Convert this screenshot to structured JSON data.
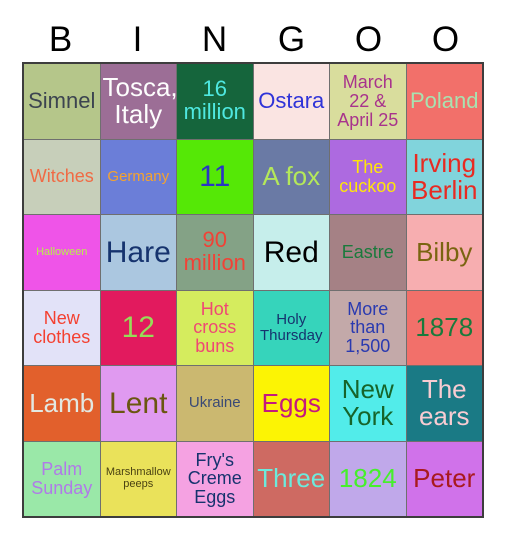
{
  "header": {
    "letters": [
      "B",
      "I",
      "N",
      "G",
      "O",
      "O"
    ],
    "letter_color": "#000000"
  },
  "grid": {
    "rows": 6,
    "columns": 6,
    "border_color": "#3d3d3d",
    "gridline_color": "#6f6f6f"
  },
  "cells": [
    {
      "text": "Simnel",
      "bg": "#b5c68a",
      "fg": "#3c4450",
      "size": "fs-md"
    },
    {
      "text": "Tosca,\nItaly",
      "bg": "#9c6e96",
      "fg": "#fdfdfd",
      "size": "fs-lg"
    },
    {
      "text": "16\nmillion",
      "bg": "#15653c",
      "fg": "#4fe8e0",
      "size": "fs-md"
    },
    {
      "text": "Ostara",
      "bg": "#fae4e2",
      "fg": "#2f33d8",
      "size": "fs-md"
    },
    {
      "text": "March\n22 &\nApril 25",
      "bg": "#d9dd9d",
      "fg": "#a8338c",
      "size": "fs-sm"
    },
    {
      "text": "Poland",
      "bg": "#f2706a",
      "fg": "#a8e2b0",
      "size": "fs-md"
    },
    {
      "text": "Witches",
      "bg": "#c7cfba",
      "fg": "#f06a44",
      "size": "fs-sm"
    },
    {
      "text": "Germany",
      "bg": "#6b7ed8",
      "fg": "#f5a32e",
      "size": "fs-xs"
    },
    {
      "text": "11",
      "bg": "#55e806",
      "fg": "#2a35c4",
      "size": "fs-xl"
    },
    {
      "text": "A fox",
      "bg": "#6a7aa5",
      "fg": "#b4e85a",
      "size": "fs-lg"
    },
    {
      "text": "The\ncuckoo",
      "bg": "#ad6ae0",
      "fg": "#ffe60a",
      "size": "fs-sm"
    },
    {
      "text": "Irving\nBerlin",
      "bg": "#81d4dc",
      "fg": "#e82a22",
      "size": "fs-lg"
    },
    {
      "text": "Halloween",
      "bg": "#ef54e8",
      "fg": "#b8ee4c",
      "size": "fs-xxs"
    },
    {
      "text": "Hare",
      "bg": "#abc7e0",
      "fg": "#16336e",
      "size": "fs-xl"
    },
    {
      "text": "90\nmillion",
      "bg": "#84a286",
      "fg": "#f14236",
      "size": "fs-md"
    },
    {
      "text": "Red",
      "bg": "#c6eeeb",
      "fg": "#000000",
      "size": "fs-xl"
    },
    {
      "text": "Eastre",
      "bg": "#a58185",
      "fg": "#1a7a3c",
      "size": "fs-sm"
    },
    {
      "text": "Bilby",
      "bg": "#f7aeb0",
      "fg": "#7a6410",
      "size": "fs-lg"
    },
    {
      "text": "New\nclothes",
      "bg": "#e2e2f8",
      "fg": "#f44030",
      "size": "fs-sm"
    },
    {
      "text": "12",
      "bg": "#e21a5e",
      "fg": "#96dd58",
      "size": "fs-xl"
    },
    {
      "text": "Hot\ncross\nbuns",
      "bg": "#d5ec5e",
      "fg": "#ef4874",
      "size": "fs-sm"
    },
    {
      "text": "Holy\nThursday",
      "bg": "#36d4bb",
      "fg": "#16336e",
      "size": "fs-xs"
    },
    {
      "text": "More\nthan\n1,500",
      "bg": "#c3a9a9",
      "fg": "#2a3ab0",
      "size": "fs-sm"
    },
    {
      "text": "1878",
      "bg": "#f2706a",
      "fg": "#1a7a3c",
      "size": "fs-lg"
    },
    {
      "text": "Lamb",
      "bg": "#e2602c",
      "fg": "#e2e8e2",
      "size": "fs-lg"
    },
    {
      "text": "Lent",
      "bg": "#e09af0",
      "fg": "#6a5610",
      "size": "fs-xl"
    },
    {
      "text": "Ukraine",
      "bg": "#cbb870",
      "fg": "#3a4a76",
      "size": "fs-xs"
    },
    {
      "text": "Eggs",
      "bg": "#fcf404",
      "fg": "#c41a7e",
      "size": "fs-lg"
    },
    {
      "text": "New\nYork",
      "bg": "#52ecea",
      "fg": "#16642a",
      "size": "fs-lg"
    },
    {
      "text": "The\nears",
      "bg": "#1a7a85",
      "fg": "#f8ccd2",
      "size": "fs-lg"
    },
    {
      "text": "Palm\nSunday",
      "bg": "#9ae8a8",
      "fg": "#b07ae8",
      "size": "fs-sm"
    },
    {
      "text": "Marshmallow\npeeps",
      "bg": "#eae25a",
      "fg": "#4a4212",
      "size": "fs-xxs"
    },
    {
      "text": "Fry's\nCreme\nEggs",
      "bg": "#f5a2e2",
      "fg": "#16336e",
      "size": "fs-sm"
    },
    {
      "text": "Three",
      "bg": "#ce6a62",
      "fg": "#6ceadc",
      "size": "fs-lg"
    },
    {
      "text": "1824",
      "bg": "#c0a8ea",
      "fg": "#46ef2c",
      "size": "fs-lg"
    },
    {
      "text": "Peter",
      "bg": "#d072ea",
      "fg": "#a81a1e",
      "size": "fs-lg"
    }
  ]
}
